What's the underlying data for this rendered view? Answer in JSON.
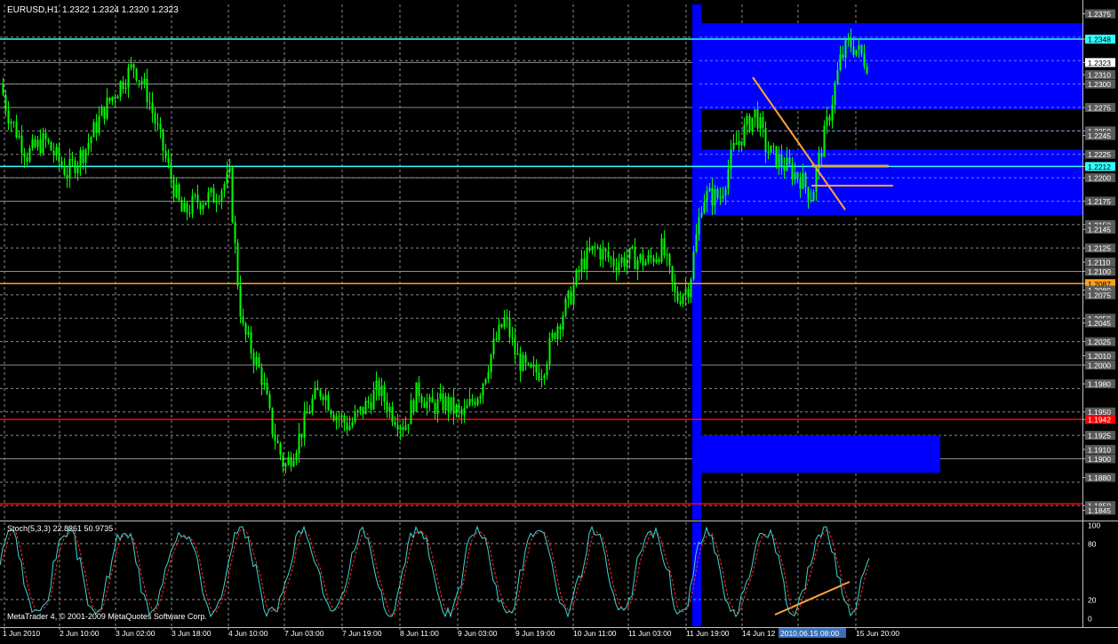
{
  "header": {
    "symbol": "EURUSD,H1",
    "ohlc": "1.2322 1.2324 1.2320 1.2323"
  },
  "colors": {
    "background": "#000000",
    "grid": "#8c8c8c",
    "candle": "#00ff00",
    "zone": "#0000ff",
    "resistance": "#33ffff",
    "pivot": "#ff9f1a",
    "support": "#ff0000",
    "level_gray": "#8c8c8c",
    "stoch_main": "#3fd5d5",
    "stoch_signal": "#ff2a2a",
    "trendline": "#ffa53a",
    "label_text": "#ffffff"
  },
  "price_axis": {
    "ticks": [
      "1.2375",
      "1.2348",
      "1.2323",
      "1.2310",
      "1.2300",
      "1.2275",
      "1.2250",
      "1.2245",
      "1.2225",
      "1.2212",
      "1.2200",
      "1.2175",
      "1.2150",
      "1.2145",
      "1.2125",
      "1.2110",
      "1.2100",
      "1.2087",
      "1.2080",
      "1.2075",
      "1.2050",
      "1.2045",
      "1.2025",
      "1.2010",
      "1.2000",
      "1.1980",
      "1.1950",
      "1.1942",
      "1.1925",
      "1.1910",
      "1.1900",
      "1.1880",
      "1.1850",
      "1.1845"
    ]
  },
  "levels": [
    {
      "label": "1.2348",
      "kind": "resistance"
    },
    {
      "label": "1.2323",
      "kind": "current"
    },
    {
      "label": "1.2212",
      "kind": "resistance"
    },
    {
      "label": "1.2087",
      "kind": "pivot"
    },
    {
      "label": "1.1942",
      "kind": "support"
    },
    {
      "label": "1.1852",
      "kind": "support"
    }
  ],
  "time_axis": {
    "labels": [
      "1 Jun 2010",
      "2 Jun 10:00",
      "3 Jun 02:00",
      "3 Jun 18:00",
      "4 Jun 10:00",
      "7 Jun 03:00",
      "7 Jun 19:00",
      "8 Jun 11:00",
      "9 Jun 03:00",
      "9 Jun 19:00",
      "10 Jun 11:00",
      "11 Jun 03:00",
      "11 Jun 19:00",
      "14 Jun 12",
      "2010.06.15 08:00",
      "15 Jun 20:00"
    ]
  },
  "indicator": {
    "title": "Stoch(5,3,3) 22.8261 50.9735",
    "levels": [
      "100",
      "80",
      "20",
      "0"
    ]
  },
  "footer": {
    "copyright": "MetaTrader 4, © 2001-2009 MetaQuotes Software Corp."
  },
  "chart_data": {
    "type": "candlestick",
    "symbol": "EURUSD",
    "timeframe": "H1",
    "ylim": [
      1.1835,
      1.2385
    ],
    "close_path": [
      [
        0,
        1.23
      ],
      [
        8,
        1.227
      ],
      [
        30,
        1.2225
      ],
      [
        50,
        1.224
      ],
      [
        75,
        1.2205
      ],
      [
        95,
        1.223
      ],
      [
        115,
        1.227
      ],
      [
        135,
        1.23
      ],
      [
        150,
        1.232
      ],
      [
        165,
        1.229
      ],
      [
        180,
        1.224
      ],
      [
        195,
        1.219
      ],
      [
        205,
        1.216
      ],
      [
        220,
        1.2175
      ],
      [
        240,
        1.218
      ],
      [
        258,
        1.22
      ],
      [
        266,
        1.21
      ],
      [
        272,
        1.204
      ],
      [
        285,
        1.201
      ],
      [
        295,
        1.1985
      ],
      [
        305,
        1.1935
      ],
      [
        320,
        1.189
      ],
      [
        335,
        1.192
      ],
      [
        350,
        1.196
      ],
      [
        362,
        1.1975
      ],
      [
        375,
        1.195
      ],
      [
        392,
        1.1935
      ],
      [
        410,
        1.1955
      ],
      [
        425,
        1.1975
      ],
      [
        440,
        1.195
      ],
      [
        455,
        1.1935
      ],
      [
        470,
        1.1975
      ],
      [
        483,
        1.1955
      ],
      [
        500,
        1.196
      ],
      [
        520,
        1.1945
      ],
      [
        540,
        1.1975
      ],
      [
        555,
        1.202
      ],
      [
        568,
        1.205
      ],
      [
        580,
        1.201
      ],
      [
        595,
        1.199
      ],
      [
        610,
        1.1995
      ],
      [
        625,
        1.204
      ],
      [
        640,
        1.207
      ],
      [
        655,
        1.211
      ],
      [
        670,
        1.2125
      ],
      [
        690,
        1.211
      ],
      [
        710,
        1.2115
      ],
      [
        728,
        1.211
      ],
      [
        745,
        1.2125
      ],
      [
        760,
        1.207
      ],
      [
        775,
        1.2085
      ],
      [
        782,
        1.213
      ],
      [
        790,
        1.218
      ],
      [
        810,
        1.218
      ],
      [
        825,
        1.223
      ],
      [
        840,
        1.2255
      ],
      [
        850,
        1.227
      ],
      [
        862,
        1.223
      ],
      [
        880,
        1.2215
      ],
      [
        900,
        1.22
      ],
      [
        913,
        1.218
      ],
      [
        920,
        1.2215
      ],
      [
        932,
        1.2265
      ],
      [
        945,
        1.2325
      ],
      [
        955,
        1.2345
      ],
      [
        965,
        1.2335
      ],
      [
        975,
        1.2323
      ]
    ],
    "zones": [
      {
        "from_x": 787,
        "to_x": 1218,
        "price_top": 1.2365,
        "price_bottom": 1.2273
      },
      {
        "from_x": 787,
        "to_x": 1218,
        "price_top": 1.223,
        "price_bottom": 1.216
      },
      {
        "from_x": 787,
        "to_x": 1058,
        "price_top": 1.1925,
        "price_bottom": 1.1885
      }
    ],
    "vertical_band": {
      "from_x": 779,
      "to_x": 789
    },
    "stochastic": {
      "k_period": 5,
      "d_period": 3,
      "slowing": 3,
      "main": 22.8261,
      "signal": 50.9735,
      "levels": [
        0,
        20,
        80,
        100
      ]
    }
  }
}
